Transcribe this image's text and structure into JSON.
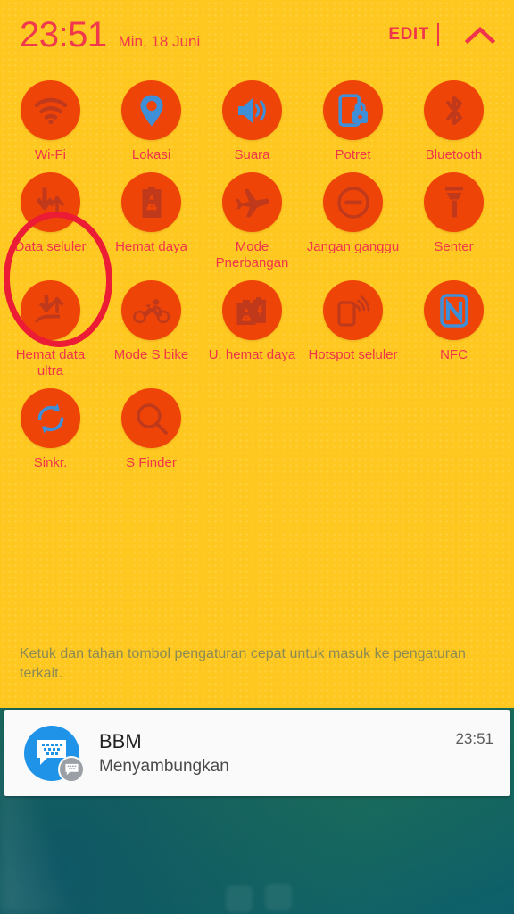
{
  "statusbar": {
    "time": "23:51",
    "date": "Min, 18 Juni",
    "edit_label": "EDIT",
    "collapse_icon": "chevron-up-icon",
    "accent_color": "#F0344B",
    "panel_color": "#FFC820"
  },
  "quick_settings": {
    "circle_color": "#EF4408",
    "icon_on_color": "#3E8FD8",
    "icon_off_color": "#C0391A",
    "rows": [
      [
        {
          "label": "Wi-Fi",
          "icon": "wifi-icon",
          "state": "off"
        },
        {
          "label": "Lokasi",
          "icon": "location-pin-icon",
          "state": "on"
        },
        {
          "label": "Suara",
          "icon": "sound-speaker-icon",
          "state": "on"
        },
        {
          "label": "Potret",
          "icon": "rotation-lock-icon",
          "state": "on"
        },
        {
          "label": "Bluetooth",
          "icon": "bluetooth-icon",
          "state": "off"
        }
      ],
      [
        {
          "label": "Data seluler",
          "icon": "mobile-data-arrows-icon",
          "state": "off"
        },
        {
          "label": "Hemat daya",
          "icon": "battery-saver-icon",
          "state": "off"
        },
        {
          "label": "Mode Pnerbangan",
          "icon": "airplane-icon",
          "state": "off"
        },
        {
          "label": "Jangan ganggu",
          "icon": "do-not-disturb-icon",
          "state": "off"
        },
        {
          "label": "Senter",
          "icon": "flashlight-icon",
          "state": "off"
        }
      ],
      [
        {
          "label": "Hemat data ultra",
          "icon": "ultra-data-saving-icon",
          "state": "off"
        },
        {
          "label": "Mode S bike",
          "icon": "motorcycle-icon",
          "state": "off"
        },
        {
          "label": "U. hemat daya",
          "icon": "ultra-power-saving-icon",
          "state": "off"
        },
        {
          "label": "Hotspot seluler",
          "icon": "mobile-hotspot-icon",
          "state": "off"
        },
        {
          "label": "NFC",
          "icon": "nfc-icon",
          "state": "on"
        }
      ],
      [
        {
          "label": "Sinkr.",
          "icon": "sync-icon",
          "state": "on"
        },
        {
          "label": "S Finder",
          "icon": "search-magnifier-icon",
          "state": "off"
        }
      ]
    ]
  },
  "hint": {
    "text": "Ketuk dan tahan tombol pengaturan cepat untuk masuk ke pengaturan terkait.",
    "color": "#8B8A55"
  },
  "annotation": {
    "shape": "ellipse-highlight",
    "target": "Data seluler",
    "color": "#ED1C35"
  },
  "notification": {
    "app_icon": "bbm-chat-bubble-icon",
    "badge_icon": "bbm-small-badge-icon",
    "title": "BBM",
    "body": "Menyambungkan",
    "time": "23:51"
  }
}
